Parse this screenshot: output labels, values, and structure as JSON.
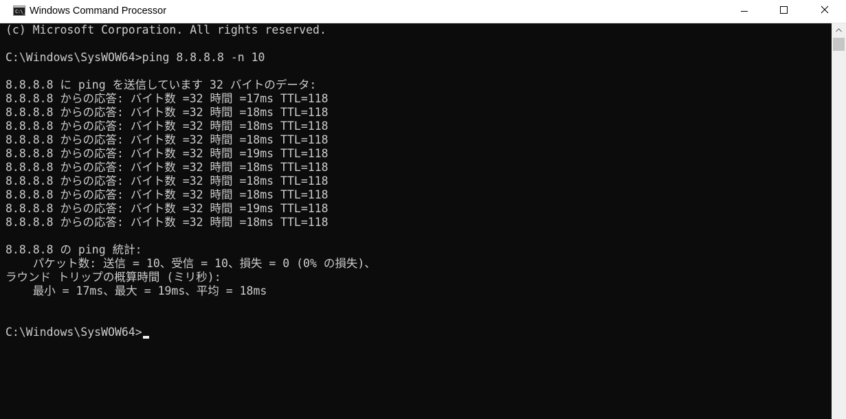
{
  "window": {
    "title": "Windows Command Processor",
    "app_icon_text": "C:\\_"
  },
  "titlebar_buttons": {
    "minimize": "minimize",
    "maximize": "maximize",
    "close": "close"
  },
  "console": {
    "lines": [
      "(c) Microsoft Corporation. All rights reserved.",
      "",
      "C:\\Windows\\SysWOW64>ping 8.8.8.8 -n 10",
      "",
      "8.8.8.8 に ping を送信しています 32 バイトのデータ:",
      "8.8.8.8 からの応答: バイト数 =32 時間 =17ms TTL=118",
      "8.8.8.8 からの応答: バイト数 =32 時間 =18ms TTL=118",
      "8.8.8.8 からの応答: バイト数 =32 時間 =18ms TTL=118",
      "8.8.8.8 からの応答: バイト数 =32 時間 =18ms TTL=118",
      "8.8.8.8 からの応答: バイト数 =32 時間 =19ms TTL=118",
      "8.8.8.8 からの応答: バイト数 =32 時間 =18ms TTL=118",
      "8.8.8.8 からの応答: バイト数 =32 時間 =18ms TTL=118",
      "8.8.8.8 からの応答: バイト数 =32 時間 =18ms TTL=118",
      "8.8.8.8 からの応答: バイト数 =32 時間 =19ms TTL=118",
      "8.8.8.8 からの応答: バイト数 =32 時間 =18ms TTL=118",
      "",
      "8.8.8.8 の ping 統計:",
      "    パケット数: 送信 = 10、受信 = 10、損失 = 0 (0% の損失)、",
      "ラウンド トリップの概算時間 (ミリ秒):",
      "    最小 = 17ms、最大 = 19ms、平均 = 18ms",
      ""
    ],
    "prompt": "C:\\Windows\\SysWOW64>"
  },
  "colors": {
    "console_background": "#0c0c0c",
    "console_text": "#cccccc",
    "titlebar_background": "#ffffff",
    "scrollbar_track": "#f0f0f0",
    "scrollbar_thumb": "#c6c6c6"
  }
}
